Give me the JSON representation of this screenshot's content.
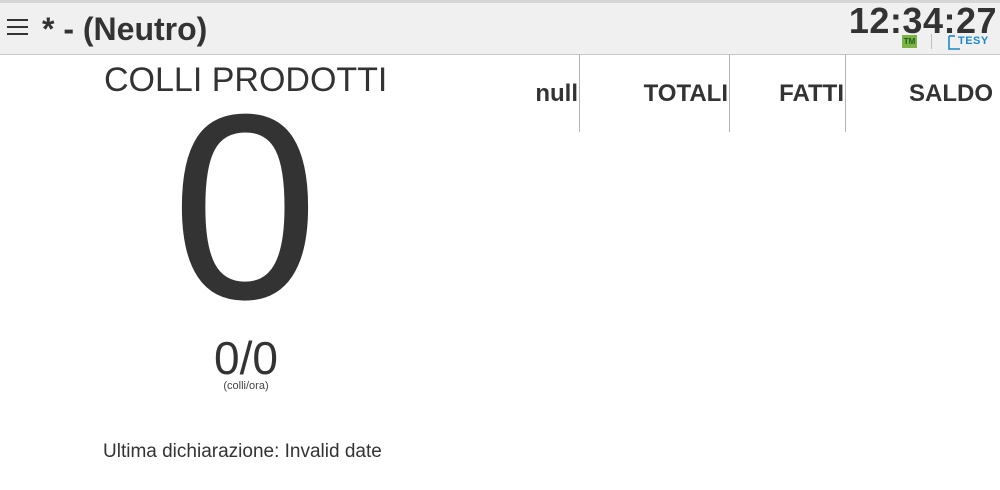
{
  "header": {
    "title": "* - (Neutro)",
    "clock": "12:34:27",
    "badge": "TM",
    "logo": "TESY"
  },
  "counter": {
    "label": "COLLI PRODOTTI",
    "value": "0",
    "rate": "0/0",
    "rate_unit": "(colli/ora)",
    "last_declaration": "Ultima dichiarazione: Invalid date"
  },
  "table": {
    "columns": [
      "null",
      "TOTALI",
      "FATTI",
      "SALDO"
    ]
  },
  "icons": {
    "menu": "hamburger-menu-icon",
    "status": "tm-status-icon",
    "brand": "tesy-logo-icon"
  },
  "colors": {
    "header_bg": "#f0f0f0",
    "text": "#333333",
    "badge_green": "#7cb342",
    "logo_blue": "#1e88c8"
  }
}
